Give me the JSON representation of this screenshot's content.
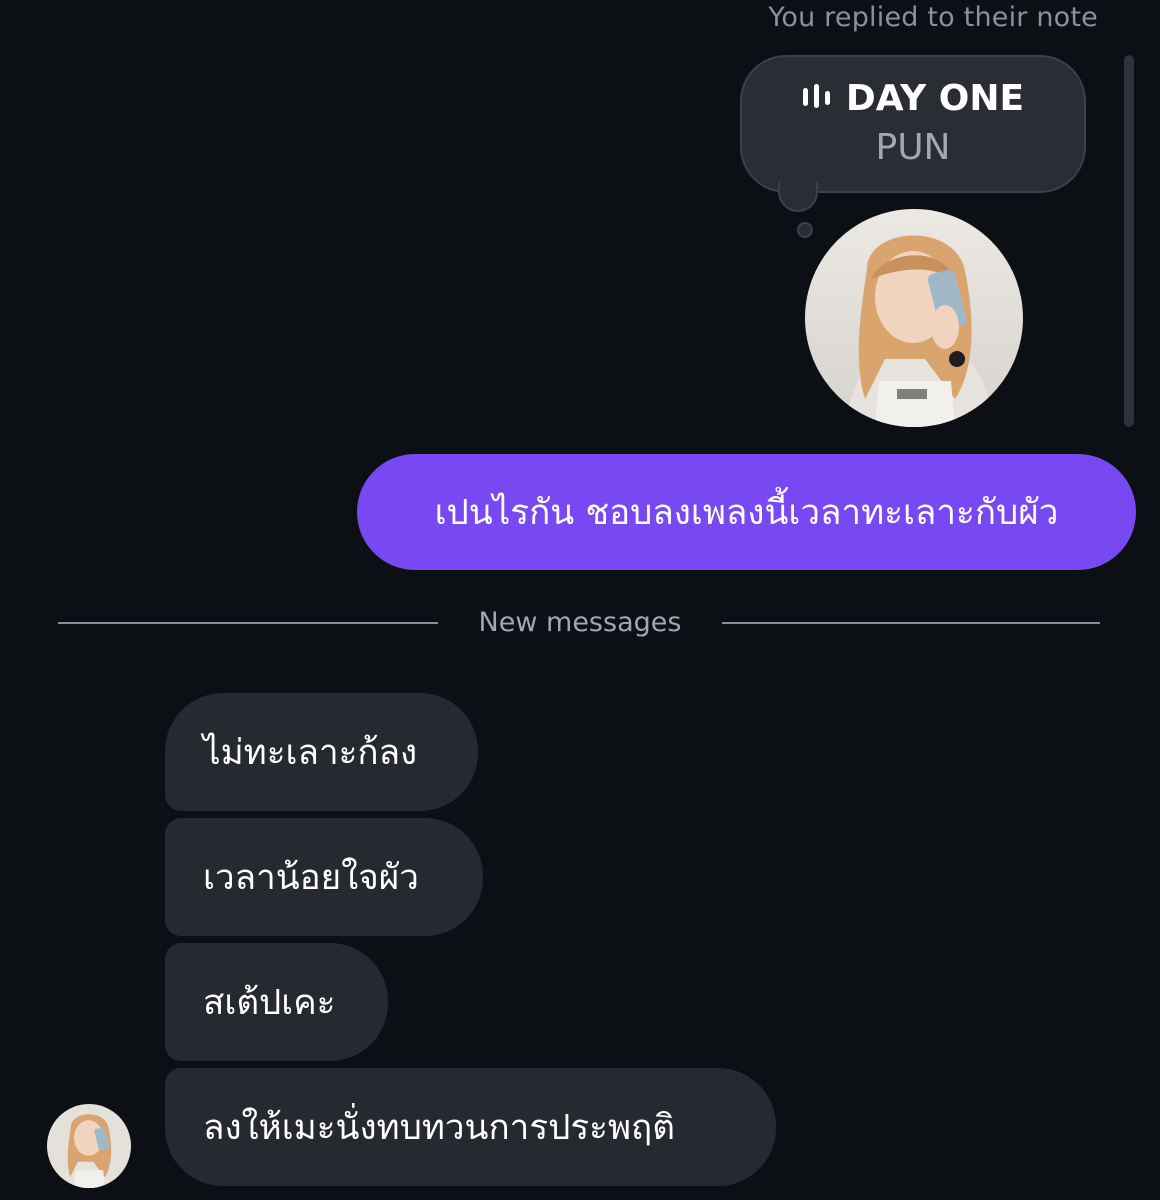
{
  "note": {
    "caption": "You replied to their note",
    "title": "DAY ONE",
    "subtitle": "PUN",
    "icon": "music-bars-icon"
  },
  "sent_message": {
    "text": "เปนไรกัน ชอบลงเพลงนี้เวลาทะเลาะกับผัว",
    "color": "#7849f2"
  },
  "divider": {
    "label": "New messages"
  },
  "received_messages": [
    {
      "text": "ไม่ทะเลาะก้ลง"
    },
    {
      "text": "เวลาน้อยใจผัว"
    },
    {
      "text": "สเต้ปเคะ"
    },
    {
      "text": "ลงให้เมะนั่งทบทวนการประพฤติ"
    }
  ]
}
